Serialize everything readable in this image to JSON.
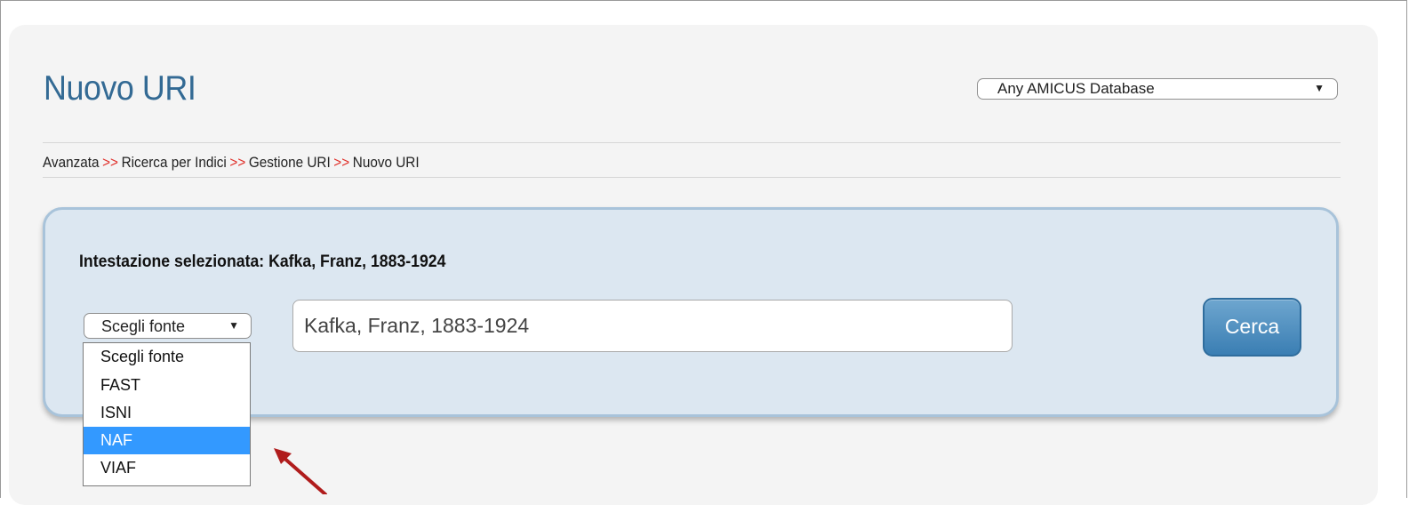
{
  "page": {
    "title": "Nuovo URI"
  },
  "database_select": {
    "value": "Any AMICUS Database"
  },
  "breadcrumb": {
    "items": [
      "Avanzata",
      "Ricerca per Indici",
      "Gestione URI",
      "Nuovo URI"
    ],
    "separator": ">>"
  },
  "panel": {
    "heading": "Intestazione selezionata: Kafka, Franz, 1883-1924",
    "source_select": {
      "value": "Scegli fonte",
      "options": [
        "Scegli fonte",
        "FAST",
        "ISNI",
        "NAF",
        "VIAF"
      ],
      "highlighted": "NAF"
    },
    "search_input": {
      "value": "Kafka, Franz, 1883-1924"
    },
    "search_button": "Cerca"
  },
  "colors": {
    "title": "#336a94",
    "separator": "#e0302a",
    "panel_bg": "#dce7f1",
    "highlight": "#3399ff",
    "annotation_arrow": "#b01c1c"
  },
  "icons": {
    "dropdown_arrow": "chevron-down-icon",
    "annotation": "red-arrow-icon"
  }
}
